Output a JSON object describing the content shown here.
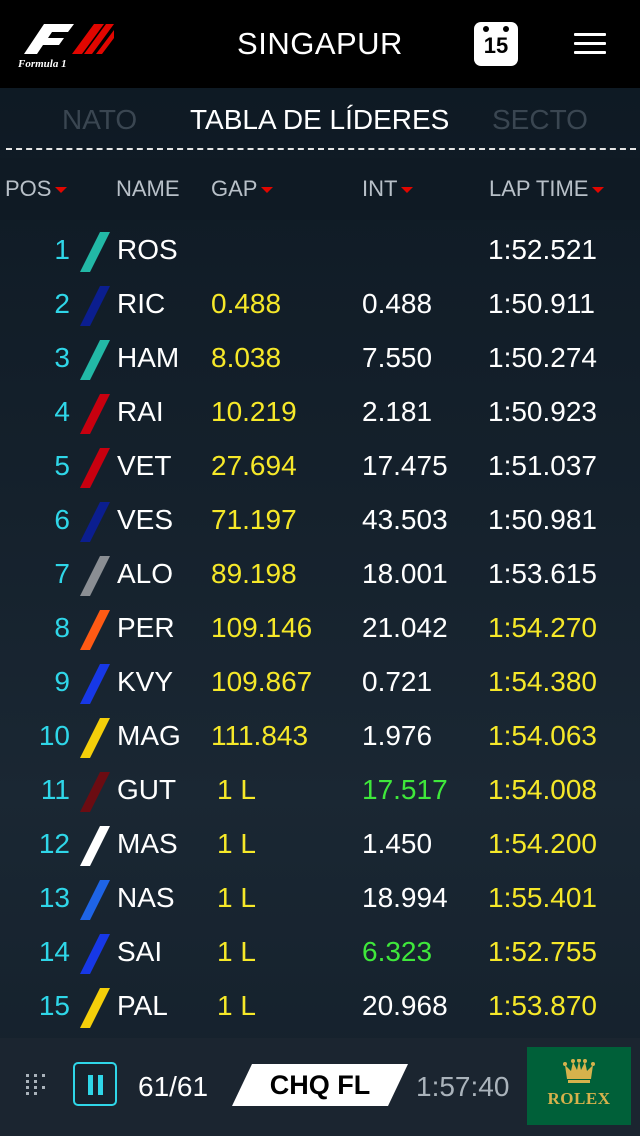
{
  "header": {
    "logo_text": "Formula 1",
    "race_title": "SINGAPUR",
    "calendar_day": "15"
  },
  "tabs": {
    "left": "NATO",
    "active": "TABLA DE LÍDERES",
    "right": "SECTO"
  },
  "table": {
    "columns": {
      "pos": "POS",
      "name": "NAME",
      "gap": "GAP",
      "int": "INT",
      "lap": "LAP TIME"
    },
    "rows": [
      {
        "pos": "1",
        "name": "ROS",
        "gap": "",
        "int": "",
        "lap": "1:52.521",
        "team_color": "#22b8a6",
        "gap_color": "yellow",
        "int_color": "white",
        "lap_color": "white"
      },
      {
        "pos": "2",
        "name": "RIC",
        "gap": "0.488",
        "int": "0.488",
        "lap": "1:50.911",
        "team_color": "#0b1e8f",
        "gap_color": "yellow",
        "int_color": "white",
        "lap_color": "white"
      },
      {
        "pos": "3",
        "name": "HAM",
        "gap": "8.038",
        "int": "7.550",
        "lap": "1:50.274",
        "team_color": "#22b8a6",
        "gap_color": "yellow",
        "int_color": "white",
        "lap_color": "white"
      },
      {
        "pos": "4",
        "name": "RAI",
        "gap": "10.219",
        "int": "2.181",
        "lap": "1:50.923",
        "team_color": "#c8000f",
        "gap_color": "yellow",
        "int_color": "white",
        "lap_color": "white"
      },
      {
        "pos": "5",
        "name": "VET",
        "gap": "27.694",
        "int": "17.475",
        "lap": "1:51.037",
        "team_color": "#c8000f",
        "gap_color": "yellow",
        "int_color": "white",
        "lap_color": "white"
      },
      {
        "pos": "6",
        "name": "VES",
        "gap": "71.197",
        "int": "43.503",
        "lap": "1:50.981",
        "team_color": "#0b1e8f",
        "gap_color": "yellow",
        "int_color": "white",
        "lap_color": "white"
      },
      {
        "pos": "7",
        "name": "ALO",
        "gap": "89.198",
        "int": "18.001",
        "lap": "1:53.615",
        "team_color": "#8a8e93",
        "gap_color": "yellow",
        "int_color": "white",
        "lap_color": "white"
      },
      {
        "pos": "8",
        "name": "PER",
        "gap": "109.146",
        "int": "21.042",
        "lap": "1:54.270",
        "team_color": "#ff5a14",
        "gap_color": "yellow",
        "int_color": "white",
        "lap_color": "yellow"
      },
      {
        "pos": "9",
        "name": "KVY",
        "gap": "109.867",
        "int": "0.721",
        "lap": "1:54.380",
        "team_color": "#1738e6",
        "gap_color": "yellow",
        "int_color": "white",
        "lap_color": "yellow"
      },
      {
        "pos": "10",
        "name": "MAG",
        "gap": "111.843",
        "int": "1.976",
        "lap": "1:54.063",
        "team_color": "#f5cf0a",
        "gap_color": "yellow",
        "int_color": "white",
        "lap_color": "yellow"
      },
      {
        "pos": "11",
        "name": "GUT",
        "gap": "1 L",
        "int": "17.517",
        "lap": "1:54.008",
        "team_color": "#6b0c12",
        "gap_color": "yellow",
        "int_color": "green",
        "lap_color": "yellow"
      },
      {
        "pos": "12",
        "name": "MAS",
        "gap": "1 L",
        "int": "1.450",
        "lap": "1:54.200",
        "team_color": "#ffffff",
        "gap_color": "yellow",
        "int_color": "white",
        "lap_color": "yellow"
      },
      {
        "pos": "13",
        "name": "NAS",
        "gap": "1 L",
        "int": "18.994",
        "lap": "1:55.401",
        "team_color": "#1e64e6",
        "gap_color": "yellow",
        "int_color": "white",
        "lap_color": "yellow"
      },
      {
        "pos": "14",
        "name": "SAI",
        "gap": "1 L",
        "int": "6.323",
        "lap": "1:52.755",
        "team_color": "#1738e6",
        "gap_color": "yellow",
        "int_color": "green",
        "lap_color": "yellow"
      },
      {
        "pos": "15",
        "name": "PAL",
        "gap": "1 L",
        "int": "20.968",
        "lap": "1:53.870",
        "team_color": "#f5cf0a",
        "gap_color": "yellow",
        "int_color": "white",
        "lap_color": "yellow"
      }
    ]
  },
  "footer": {
    "laps": "61/61",
    "flag_label": "CHQ FL",
    "clock": "1:57:40",
    "sponsor": "ROLEX"
  },
  "icons": {
    "logo": "f1-logo",
    "calendar": "calendar-icon",
    "menu": "hamburger-menu-icon",
    "grip": "grip-icon",
    "pause": "pause-icon",
    "sponsor": "rolex-crown-icon"
  }
}
